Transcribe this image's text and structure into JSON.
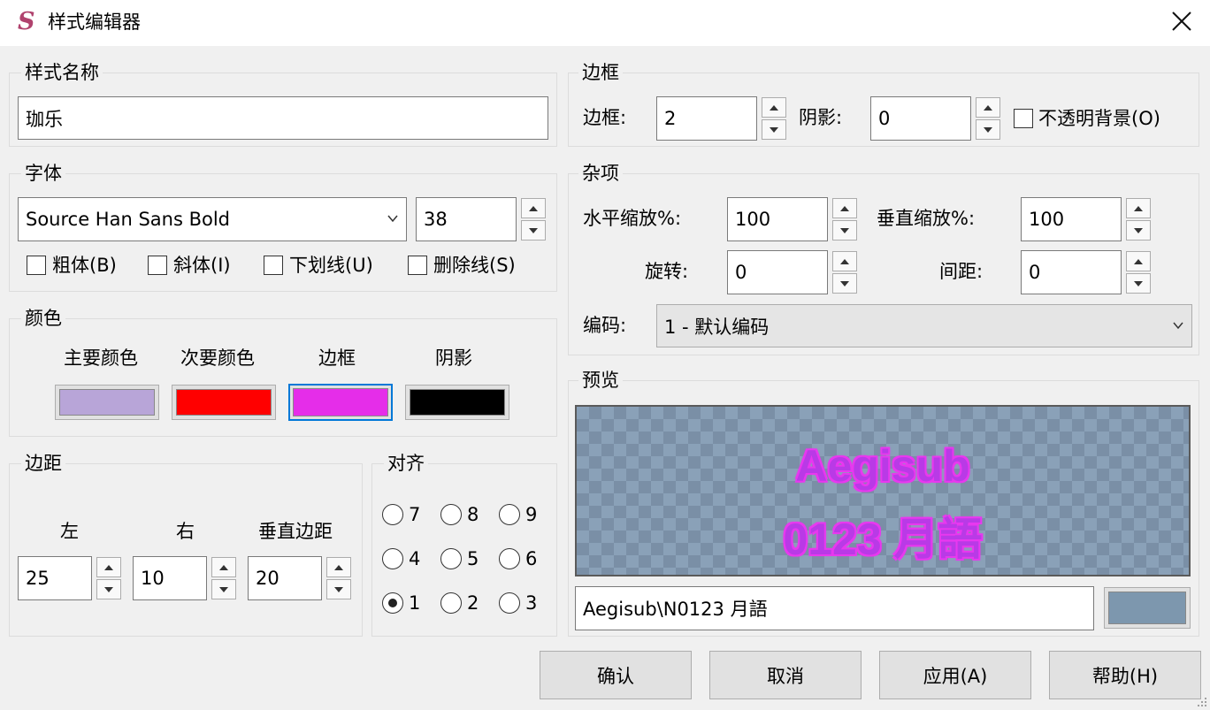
{
  "window": {
    "title": "样式编辑器",
    "app_icon_glyph": "S"
  },
  "style_name": {
    "label": "样式名称",
    "value": "珈乐"
  },
  "font": {
    "label": "字体",
    "family": "Source Han Sans Bold",
    "size": "38",
    "checkboxes": [
      {
        "label": "粗体(B)",
        "checked": false
      },
      {
        "label": "斜体(I)",
        "checked": false
      },
      {
        "label": "下划线(U)",
        "checked": false
      },
      {
        "label": "删除线(S)",
        "checked": false
      }
    ]
  },
  "colors": {
    "label": "颜色",
    "items": [
      {
        "label": "主要颜色",
        "color": "#b8a5d8"
      },
      {
        "label": "次要颜色",
        "color": "#ff0000"
      },
      {
        "label": "边框",
        "color": "#e52de9"
      },
      {
        "label": "阴影",
        "color": "#000000"
      }
    ]
  },
  "margins": {
    "label": "边距",
    "left_label": "左",
    "left_value": "25",
    "right_label": "右",
    "right_value": "10",
    "vertical_label": "垂直边距",
    "vertical_value": "20"
  },
  "alignment": {
    "label": "对齐",
    "options": [
      "7",
      "8",
      "9",
      "4",
      "5",
      "6",
      "1",
      "2",
      "3"
    ],
    "selected": "1"
  },
  "border": {
    "label": "边框",
    "outline_label": "边框:",
    "outline_value": "2",
    "shadow_label": "阴影:",
    "shadow_value": "0",
    "opaque_label": "不透明背景(O)",
    "opaque_checked": false
  },
  "misc": {
    "label": "杂项",
    "scale_x_label": "水平缩放%:",
    "scale_x_value": "100",
    "scale_y_label": "垂直缩放%:",
    "scale_y_value": "100",
    "rotation_label": "旋转:",
    "rotation_value": "0",
    "spacing_label": "间距:",
    "spacing_value": "0",
    "encoding_label": "编码:",
    "encoding_value": "1 - 默认编码"
  },
  "preview": {
    "label": "预览",
    "line1": "Aegisub",
    "line2": "0123 月語",
    "text_input": "Aegisub\\N0123 月語",
    "bg_color": "#7d97ae"
  },
  "buttons": {
    "ok": "确认",
    "cancel": "取消",
    "apply": "应用(A)",
    "help": "帮助(H)"
  }
}
